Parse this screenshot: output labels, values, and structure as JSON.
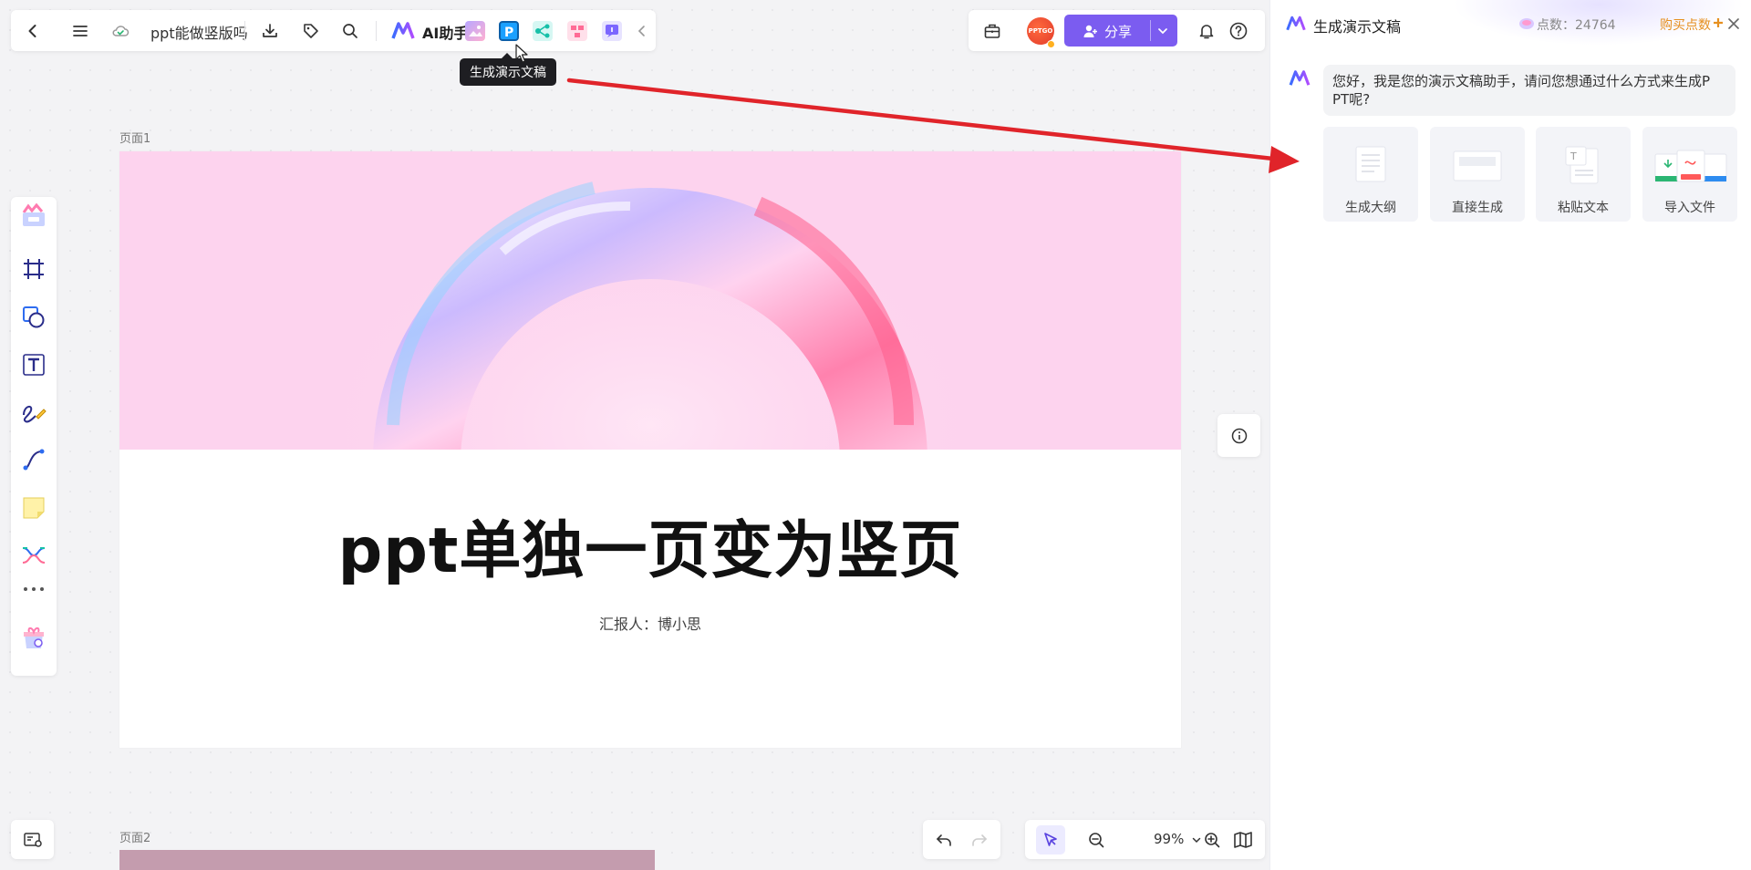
{
  "topbar": {
    "doc_title": "ppt能做竖版吗",
    "ai_label": "AI助手",
    "tooltip": "生成演示文稿"
  },
  "rightbar": {
    "share_label": "分享",
    "avatar_text": "PPTGO"
  },
  "canvas": {
    "page1_label": "页面1",
    "page2_label": "页面2"
  },
  "slide1": {
    "title": "ppt单独一页变为竖页",
    "reporter": "汇报人：博小思"
  },
  "zoom": {
    "level": "99%"
  },
  "panel": {
    "title": "生成演示文稿",
    "points_label": "点数：24764",
    "buy_label": "购买点数",
    "greeting_line1": "您好，我是您的演示文稿助手，请问您想通过什么方式来生成P",
    "greeting_line2": "PT呢?",
    "options": [
      {
        "label": "生成大纲"
      },
      {
        "label": "直接生成"
      },
      {
        "label": "粘贴文本"
      },
      {
        "label": "导入文件"
      }
    ]
  },
  "colors": {
    "accent": "#7b5cf0",
    "arrow": "#e0242a",
    "banner": "#fdd3ee",
    "buy": "#e69020"
  }
}
